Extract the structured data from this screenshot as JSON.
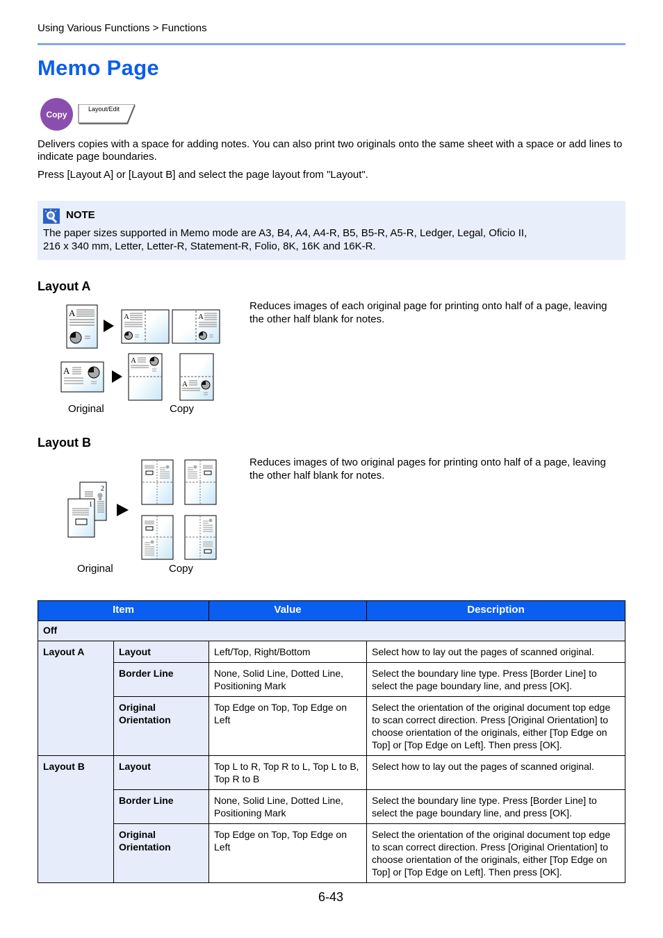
{
  "header": {
    "breadcrumb": "Using Various Functions > Functions",
    "title": "Memo Page",
    "mode_badge": "Copy",
    "tab_label": "Layout/Edit"
  },
  "intro": {
    "paragraph1": "Delivers copies with a space for adding notes. You can also print two originals onto the same sheet with a space or add lines to indicate page boundaries.",
    "paragraph2": "Press [Layout A] or [Layout B] and select the page layout from \"Layout\"."
  },
  "note": {
    "icon": "note-icon",
    "heading": "NOTE",
    "text_line1": "The paper sizes supported in Memo mode are A3, B4, A4, A4-R, B5, B5-R, A5-R, Ledger, Legal, Oficio II,",
    "text_line2": "216 x 340 mm, Letter, Letter-R, Statement-R, Folio, 8K, 16K and 16K-R."
  },
  "layout_a": {
    "heading": "Layout A",
    "description": "Reduces images of each original page for printing onto half of a page, leaving the other half blank for notes.",
    "caption_original": "Original",
    "caption_copy": "Copy",
    "glyph": "A"
  },
  "layout_b": {
    "heading": "Layout B",
    "description": "Reduces images of two original pages for printing onto half of a page, leaving the other half blank for notes.",
    "caption_original": "Original",
    "caption_copy": "Copy",
    "page1": "1",
    "page2": "2"
  },
  "table": {
    "headers": [
      "Item",
      "Value",
      "Description"
    ],
    "off_label": "Off",
    "groups": [
      {
        "label": "Layout A",
        "rows": [
          {
            "item": "Layout",
            "value": "Left/Top, Right/Bottom",
            "description": "Select how to lay out the pages of scanned original."
          },
          {
            "item": "Border Line",
            "value": "None, Solid Line, Dotted Line, Positioning Mark",
            "description": "Select the boundary line type. Press [Border Line] to select the page boundary line, and press [OK]."
          },
          {
            "item": "Original Orientation",
            "value": "Top Edge on Top, Top Edge on Left",
            "description": "Select the orientation of the original document top edge to scan correct direction. Press [Original Orientation] to choose orientation of the originals, either [Top Edge on Top] or [Top Edge on Left]. Then press [OK]."
          }
        ]
      },
      {
        "label": "Layout B",
        "rows": [
          {
            "item": "Layout",
            "value": "Top L to R, Top R to L, Top L to B, Top R to B",
            "description": "Select how to lay out the pages of scanned original."
          },
          {
            "item": "Border Line",
            "value": "None, Solid Line, Dotted Line, Positioning Mark",
            "description": "Select the boundary line type. Press [Border Line] to select the page boundary line, and press [OK]."
          },
          {
            "item": "Original Orientation",
            "value": "Top Edge on Top, Top Edge on Left",
            "description": "Select the orientation of the original document top edge to scan correct direction. Press [Original Orientation] to choose orientation of the originals, either [Top Edge on Top] or [Top Edge on Left]. Then press [OK]."
          }
        ]
      }
    ]
  },
  "footer": {
    "page_number": "6-43"
  },
  "colors": {
    "title_blue": "#0a5ef0",
    "header_rule": "#7fa7ef",
    "copy_badge": "#8a4fae",
    "note_bg": "#e8eefa",
    "table_header": "#0a5ef0",
    "table_shade": "#e6ecfa"
  }
}
